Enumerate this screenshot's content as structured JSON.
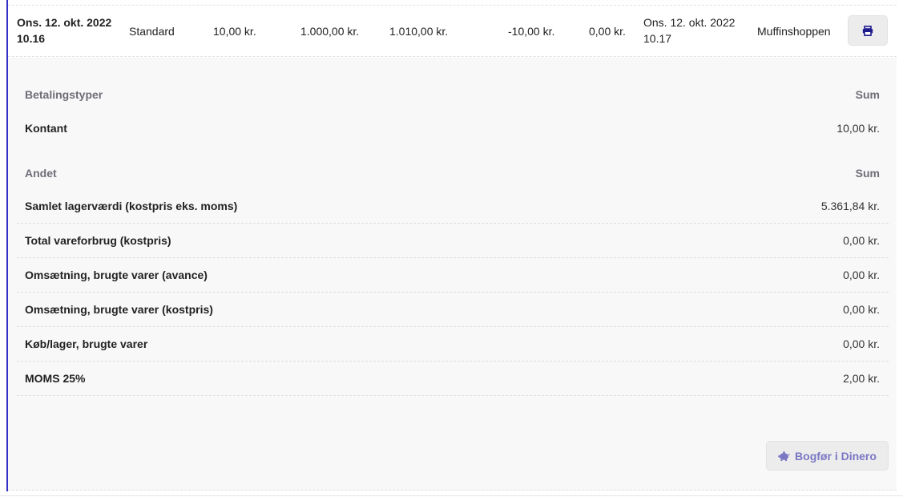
{
  "summary": {
    "opened": "Ons. 12. okt. 2022",
    "opened_time": "10.16",
    "type": "Standard",
    "amount1": "10,00 kr.",
    "amount2": "1.000,00 kr.",
    "amount3": "1.010,00 kr.",
    "amount4": "-10,00 kr.",
    "amount5": "0,00 kr.",
    "closed": "Ons. 12. okt. 2022",
    "closed_time": "10.17",
    "shop": "Muffinshoppen",
    "print_icon": "printer-icon"
  },
  "payment_types": {
    "header": "Betalingstyper",
    "sum_header": "Sum",
    "rows": [
      {
        "label": "Kontant",
        "value": "10,00 kr."
      }
    ]
  },
  "other": {
    "header": "Andet",
    "sum_header": "Sum",
    "rows": [
      {
        "label": "Samlet lagerværdi (kostpris eks. moms)",
        "value": "5.361,84 kr."
      },
      {
        "label": "Total vareforbrug (kostpris)",
        "value": "0,00 kr."
      },
      {
        "label": "Omsætning, brugte varer (avance)",
        "value": "0,00 kr."
      },
      {
        "label": "Omsætning, brugte varer (kostpris)",
        "value": "0,00 kr."
      },
      {
        "label": "Køb/lager, brugte varer",
        "value": "0,00 kr."
      },
      {
        "label": "MOMS 25%",
        "value": "2,00 kr."
      }
    ]
  },
  "actions": {
    "bogfor_label": "Bogfør i Dinero",
    "bogfor_icon": "piggy-bank-icon"
  },
  "colors": {
    "accent": "#3330c8",
    "button_text": "#7a77c4"
  }
}
